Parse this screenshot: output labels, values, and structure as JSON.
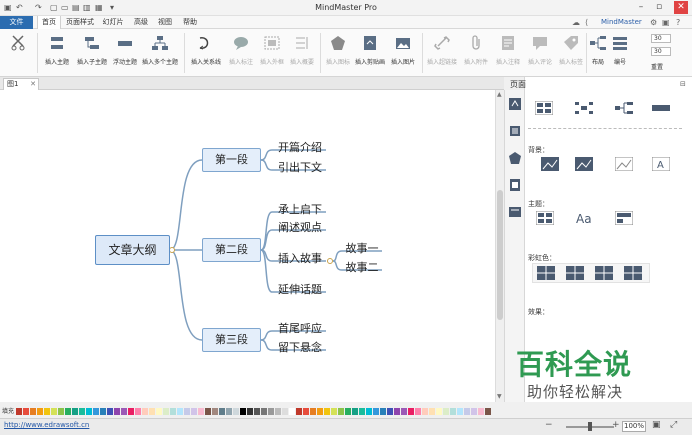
{
  "app": {
    "title": "MindMaster Pro",
    "brand": "MindMaster"
  },
  "menu": {
    "file": "文件",
    "tabs": [
      "首页",
      "页面样式",
      "幻灯片",
      "高级",
      "视图",
      "帮助"
    ]
  },
  "ribbon": {
    "buttons": [
      "插入主题",
      "插入子主题",
      "浮动主题",
      "插入多个主题",
      "插入关系线",
      "插入标注",
      "插入外框",
      "插入概要",
      "插入图标",
      "插入剪贴画",
      "插入图片",
      "插入超链接",
      "插入附件",
      "插入注释",
      "插入评论",
      "插入标签",
      "布局",
      "编号"
    ],
    "spin1": "30",
    "spin2": "30",
    "reset": "重置"
  },
  "doc": {
    "tab": "图1"
  },
  "mindmap": {
    "root": "文章大纲",
    "branches": [
      {
        "label": "第一段",
        "children": [
          "开篇介绍",
          "引出下文"
        ]
      },
      {
        "label": "第二段",
        "children": [
          "承上启下",
          "阐述观点",
          "插入故事",
          "延伸话题"
        ],
        "grandchildren": [
          "故事一",
          "故事二"
        ]
      },
      {
        "label": "第三段",
        "children": [
          "首尾呼应",
          "留下悬念"
        ]
      }
    ]
  },
  "panel": {
    "title": "页面",
    "background": "背景：",
    "theme": "主题：",
    "rainbow": "彩虹色：",
    "effect": "效果："
  },
  "watermark": {
    "logo": "百科全说",
    "sub": "助你轻松解决"
  },
  "colorbar": {
    "label": "填充"
  },
  "status": {
    "url": "http://www.edrawsoft.cn",
    "zoom": "100%"
  },
  "colors": {
    "accent": "#2b6cb0",
    "node_fill": "#e4eefa",
    "line": "#7f9fbf",
    "watermark": "#2f9a52"
  }
}
